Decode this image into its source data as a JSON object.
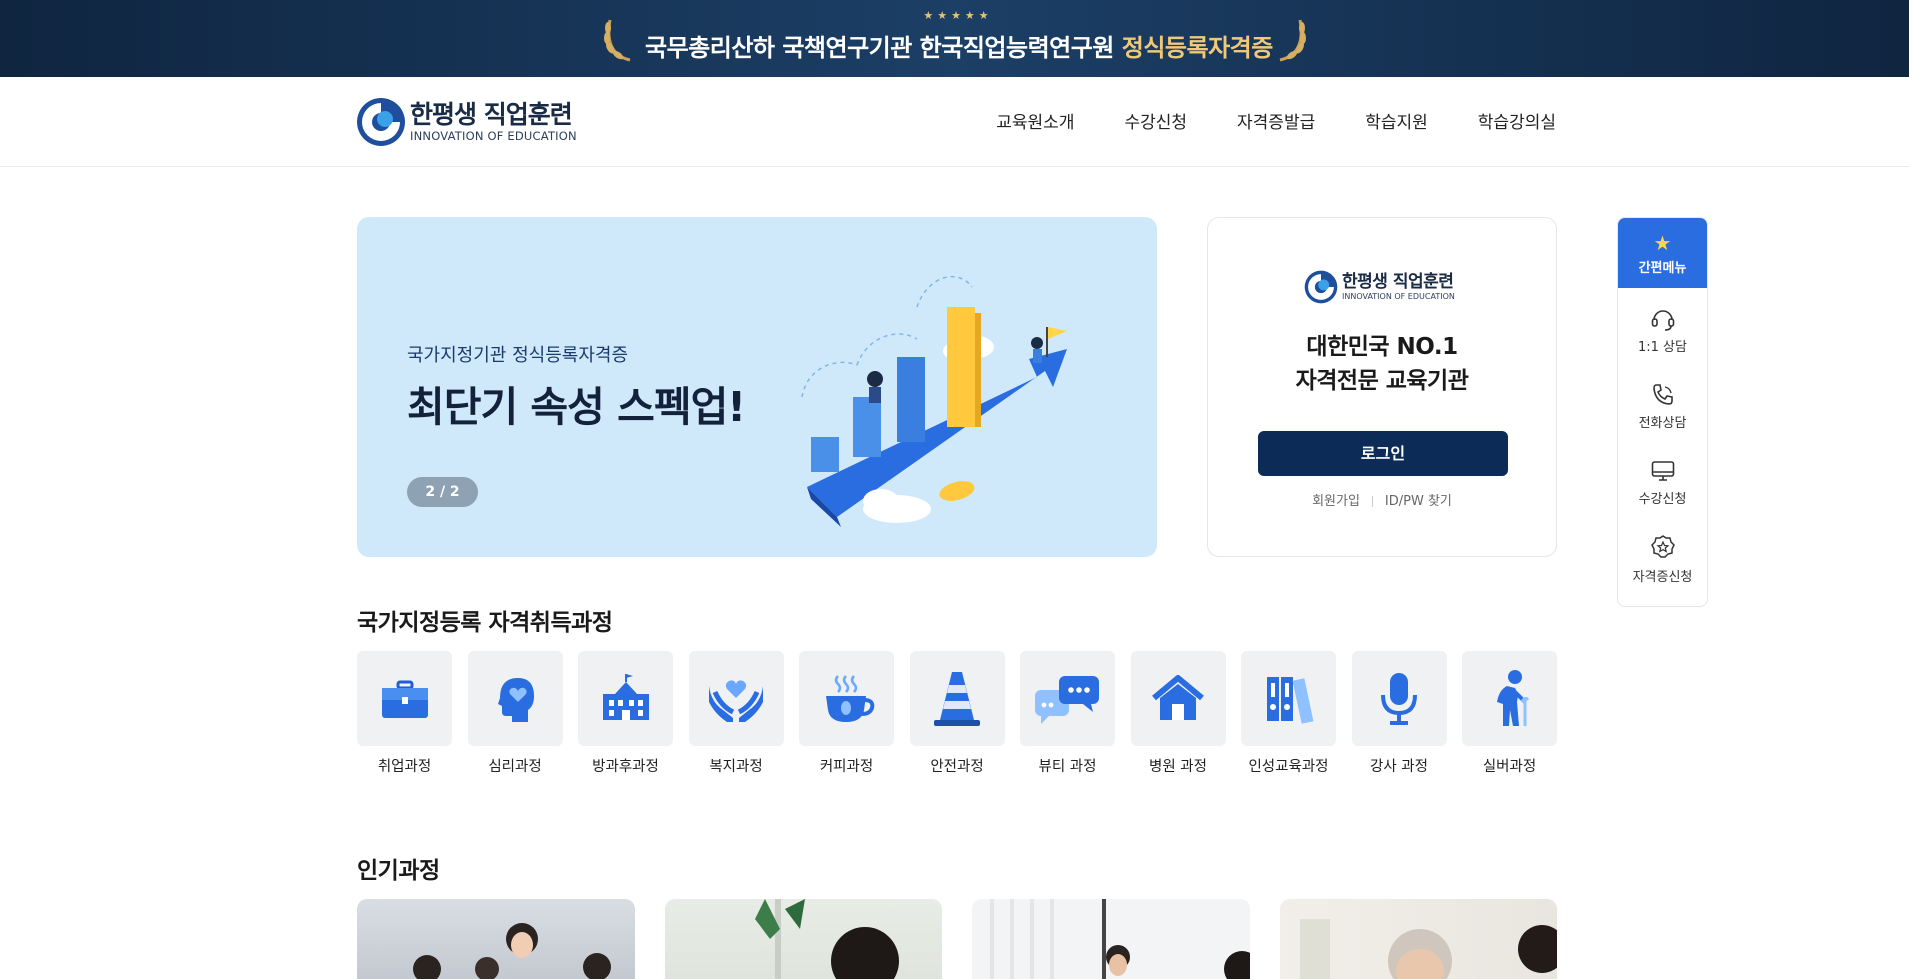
{
  "top_banner": {
    "stars": "★★★★★",
    "message_main": "국무총리산하 국책연구기관 한국직업능력연구원 ",
    "message_highlight": "정식등록자격증"
  },
  "header": {
    "logo_ko": "한평생 직업훈련",
    "logo_en": "INNOVATION OF EDUCATION",
    "nav": [
      "교육원소개",
      "수강신청",
      "자격증발급",
      "학습지원",
      "학습강의실"
    ]
  },
  "hero": {
    "subtitle": "국가지정기관 정식등록자격증",
    "title": "최단기 속성 스펙업!",
    "pager": "2 / 2"
  },
  "login": {
    "logo_ko": "한평생 직업훈련",
    "logo_en": "INNOVATION OF EDUCATION",
    "slogan_line1": "대한민국 NO.1",
    "slogan_line2": "자격전문 교육기관",
    "login_button": "로그인",
    "signup_link": "회원가입",
    "find_link": "ID/PW 찾기"
  },
  "quick_menu": {
    "title": "간편메뉴",
    "items": [
      {
        "label": "1:1 상담",
        "icon": "headset-icon"
      },
      {
        "label": "전화상담",
        "icon": "phone-icon"
      },
      {
        "label": "수강신청",
        "icon": "monitor-icon"
      },
      {
        "label": "자격증신청",
        "icon": "badge-icon"
      }
    ]
  },
  "courses": {
    "title": "국가지정등록 자격취득과정",
    "items": [
      {
        "label": "취업과정",
        "icon": "briefcase-icon"
      },
      {
        "label": "심리과정",
        "icon": "head-heart-icon"
      },
      {
        "label": "방과후과정",
        "icon": "school-icon"
      },
      {
        "label": "복지과정",
        "icon": "hands-heart-icon"
      },
      {
        "label": "커피과정",
        "icon": "coffee-icon"
      },
      {
        "label": "안전과정",
        "icon": "traffic-cone-icon"
      },
      {
        "label": "뷰티 과정",
        "icon": "chat-bubbles-icon"
      },
      {
        "label": "병원 과정",
        "icon": "house-icon"
      },
      {
        "label": "인성교육과정",
        "icon": "binders-icon"
      },
      {
        "label": "강사 과정",
        "icon": "microphone-icon"
      },
      {
        "label": "실버과정",
        "icon": "elderly-icon"
      }
    ]
  },
  "popular": {
    "title": "인기과정"
  },
  "colors": {
    "navy": "#0c2b57",
    "accent_blue": "#2a6de0",
    "hero_bg": "#cfe9fb",
    "gold": "#f0c879"
  }
}
